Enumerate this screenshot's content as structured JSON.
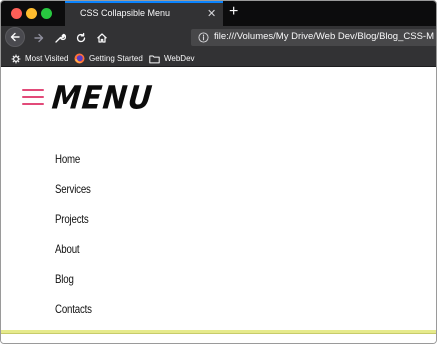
{
  "browser": {
    "tab": {
      "title": "CSS Collapsible Menu",
      "close_glyph": "✕"
    },
    "new_tab_glyph": "+",
    "url": "file:///Volumes/My Drive/Web Dev/Blog/Blog_CSS-M",
    "icons": {
      "back": "back-arrow-icon",
      "forward": "forward-arrow-icon",
      "tools": "wrench-icon",
      "reload": "reload-icon",
      "home": "home-icon",
      "info": "info-icon"
    },
    "bookmarks": [
      {
        "label": "Most Visited",
        "icon": "gear-icon"
      },
      {
        "label": "Getting Started",
        "icon": "firefox-icon"
      },
      {
        "label": "WebDev",
        "icon": "folder-icon"
      }
    ]
  },
  "page": {
    "title": "MENU",
    "hamburger_color": "#e24a79",
    "menu_items": [
      "Home",
      "Services",
      "Projects",
      "About",
      "Blog",
      "Contacts"
    ]
  }
}
